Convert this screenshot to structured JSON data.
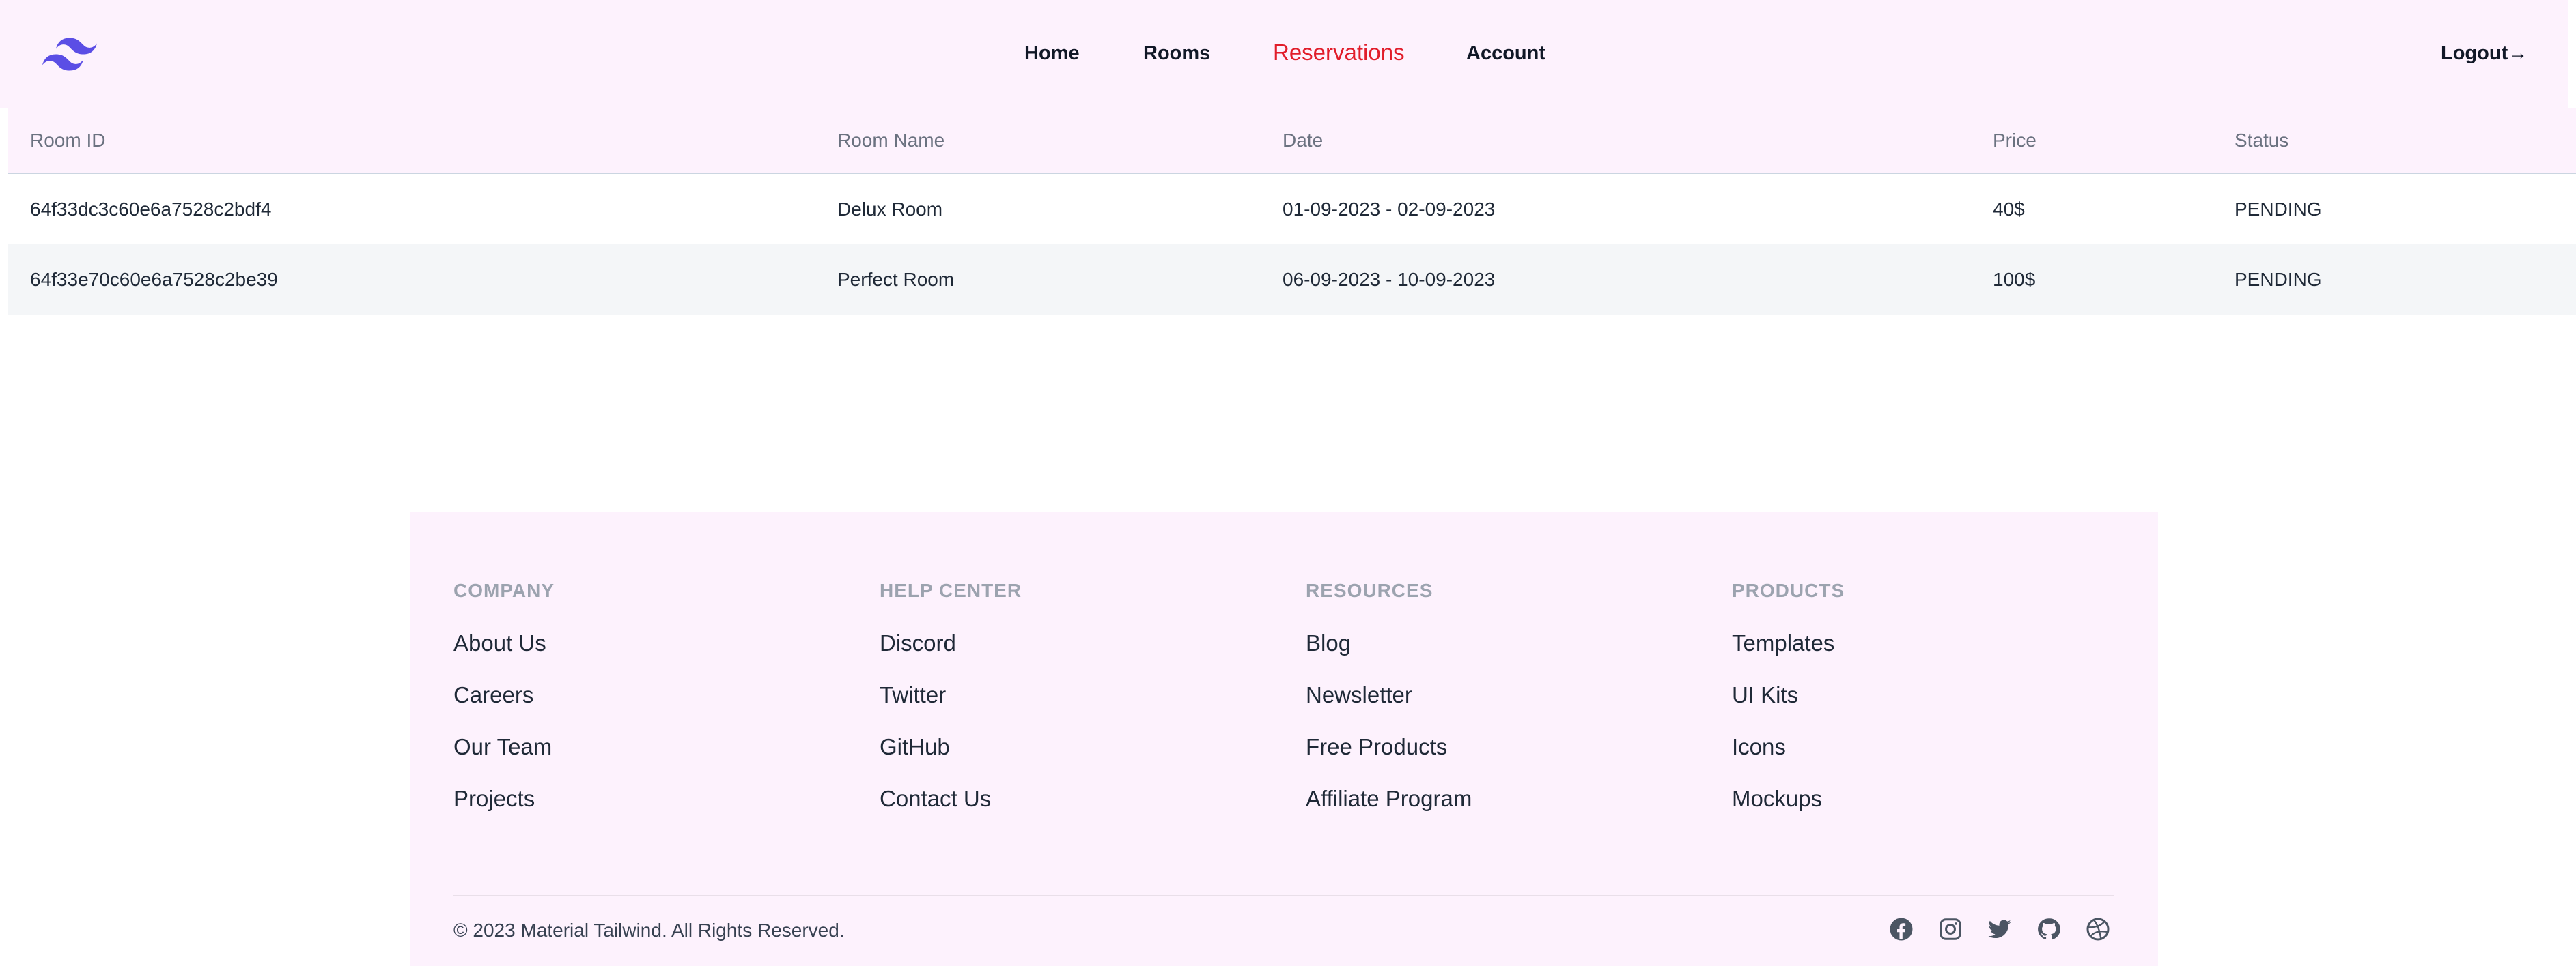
{
  "nav": {
    "home": "Home",
    "rooms": "Rooms",
    "reservations": "Reservations",
    "account": "Account",
    "logout": "Logout→",
    "active": "Reservations"
  },
  "table": {
    "headers": [
      "Room ID",
      "Room Name",
      "Date",
      "Price",
      "Status"
    ],
    "rows": [
      [
        "64f33dc3c60e6a7528c2bdf4",
        "Delux Room",
        "01-09-2023 - 02-09-2023",
        "40$",
        "PENDING"
      ],
      [
        "64f33e70c60e6a7528c2be39",
        "Perfect Room",
        "06-09-2023 - 10-09-2023",
        "100$",
        "PENDING"
      ]
    ]
  },
  "footer": {
    "columns": [
      {
        "title": "COMPANY",
        "links": [
          "About Us",
          "Careers",
          "Our Team",
          "Projects"
        ]
      },
      {
        "title": "HELP CENTER",
        "links": [
          "Discord",
          "Twitter",
          "GitHub",
          "Contact Us"
        ]
      },
      {
        "title": "RESOURCES",
        "links": [
          "Blog",
          "Newsletter",
          "Free Products",
          "Affiliate Program"
        ]
      },
      {
        "title": "PRODUCTS",
        "links": [
          "Templates",
          "UI Kits",
          "Icons",
          "Mockups"
        ]
      }
    ],
    "copyright": "© 2023 Material Tailwind. All Rights Reserved.",
    "social_icons": [
      "facebook-icon",
      "instagram-icon",
      "twitter-icon",
      "github-icon",
      "dribbble-icon"
    ]
  },
  "colors": {
    "nav_bg": "#fdf2fd",
    "active_link": "#e11d2a",
    "logo": "#5b4ee5",
    "footer_bg": "#fdf2fd"
  }
}
